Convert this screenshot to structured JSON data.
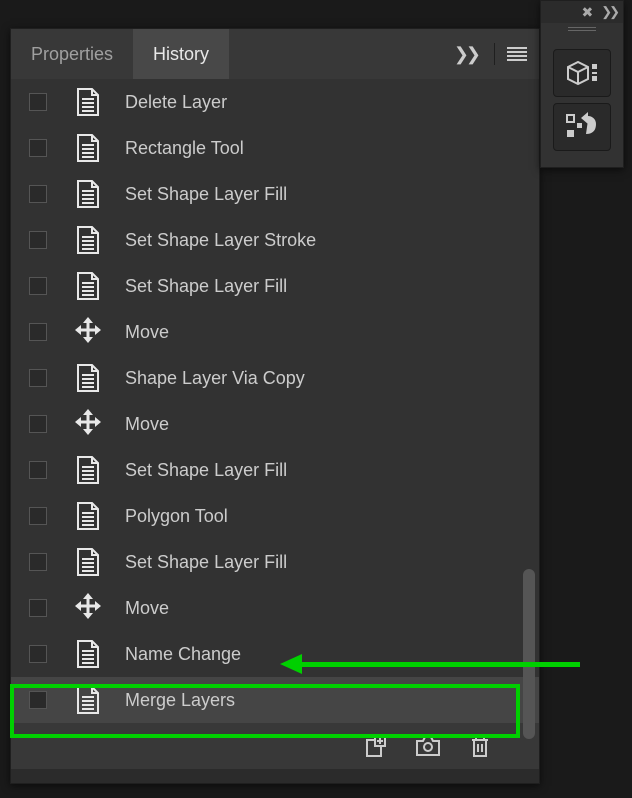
{
  "tabs": {
    "properties": "Properties",
    "history": "History"
  },
  "history": [
    {
      "label": "Delete Layer",
      "icon": "document"
    },
    {
      "label": "Rectangle Tool",
      "icon": "document"
    },
    {
      "label": "Set Shape Layer Fill",
      "icon": "document"
    },
    {
      "label": "Set Shape Layer Stroke",
      "icon": "document"
    },
    {
      "label": "Set Shape Layer Fill",
      "icon": "document"
    },
    {
      "label": "Move",
      "icon": "move"
    },
    {
      "label": "Shape Layer Via Copy",
      "icon": "document"
    },
    {
      "label": "Move",
      "icon": "move"
    },
    {
      "label": "Set Shape Layer Fill",
      "icon": "document"
    },
    {
      "label": "Polygon Tool",
      "icon": "document"
    },
    {
      "label": "Set Shape Layer Fill",
      "icon": "document"
    },
    {
      "label": "Move",
      "icon": "move"
    },
    {
      "label": "Name Change",
      "icon": "document"
    },
    {
      "label": "Merge Layers",
      "icon": "document",
      "selected": true
    }
  ],
  "side_buttons": [
    "3d-icon",
    "history-state-icon"
  ]
}
